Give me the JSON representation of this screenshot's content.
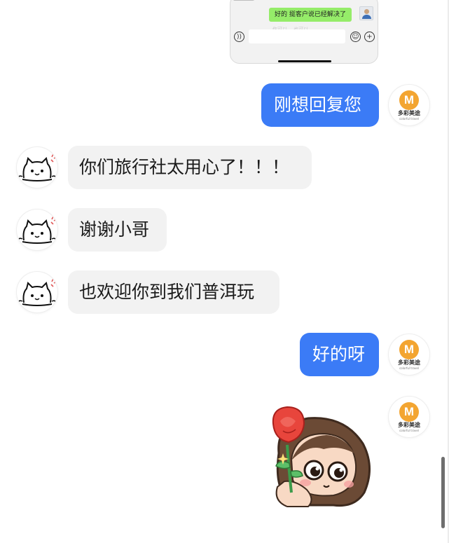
{
  "embedded_screenshot": {
    "message": "好的 挺客户说已经解决了",
    "faint_text": "你可以…  也可以…"
  },
  "messages": [
    {
      "side": "right",
      "text": "刚想回复您"
    },
    {
      "side": "left",
      "text": "你们旅行社太用心了！！！"
    },
    {
      "side": "left",
      "text": "谢谢小哥"
    },
    {
      "side": "left",
      "text": "也欢迎你到我们普洱玩"
    },
    {
      "side": "right",
      "text": "好的呀"
    }
  ],
  "agency_avatar": {
    "brand_name": "多彩美途",
    "brand_sub": "colorful travel",
    "logo_color": "#f3a531"
  },
  "colors": {
    "outgoing_bubble": "#3b7bf6",
    "incoming_bubble": "#f2f2f2",
    "embedded_message_bubble": "#95ec69"
  },
  "sticker": {
    "icon": "girl-holding-rose-sticker"
  },
  "icons": {
    "voice": "voice-icon",
    "emoji": "emoji-icon",
    "plus": "plus-icon",
    "customer_avatar": "cat-avatar-icon"
  }
}
